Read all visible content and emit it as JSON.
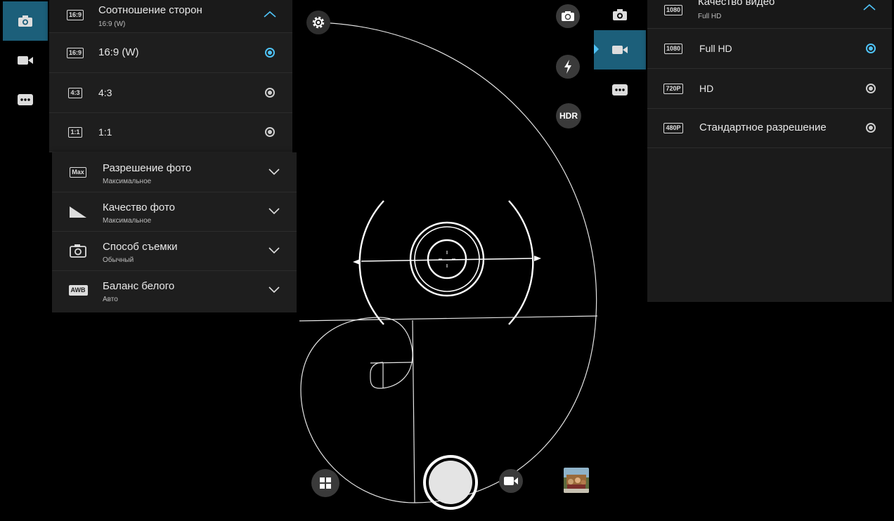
{
  "left_panel": {
    "header": {
      "title": "Соотношение сторон",
      "subtitle": "16:9 (W)",
      "badge": "16:9"
    },
    "options": [
      {
        "badge": "16:9",
        "label": "16:9 (W)",
        "selected": true
      },
      {
        "badge": "4:3",
        "label": "4:3",
        "selected": false
      },
      {
        "badge": "1:1",
        "label": "1:1",
        "selected": false
      }
    ],
    "settings": [
      {
        "icon": "max-resolution-icon",
        "badge": "Max",
        "title": "Разрешение фото",
        "subtitle": "Максимальное"
      },
      {
        "icon": "photo-quality-icon",
        "title": "Качество фото",
        "subtitle": "Максимальное"
      },
      {
        "icon": "shooting-mode-icon",
        "title": "Способ съемки",
        "subtitle": "Обычный"
      },
      {
        "icon": "white-balance-icon",
        "badge": "AWB",
        "title": "Баланс белого",
        "subtitle": "Авто"
      }
    ]
  },
  "right_panel": {
    "header": {
      "title": "Качество видео",
      "subtitle": "Full HD",
      "badge": "1080"
    },
    "options": [
      {
        "badge": "1080",
        "label": "Full HD",
        "selected": true
      },
      {
        "badge": "720P",
        "label": "HD",
        "selected": false
      },
      {
        "badge": "480P",
        "label": "Стандартное разрешение",
        "selected": false
      }
    ]
  },
  "controls": {
    "hdr_label": "HDR"
  },
  "colors": {
    "accent": "#4fc3f7",
    "active_mode": "#1c5f7a",
    "panel": "#1e1e1e"
  }
}
